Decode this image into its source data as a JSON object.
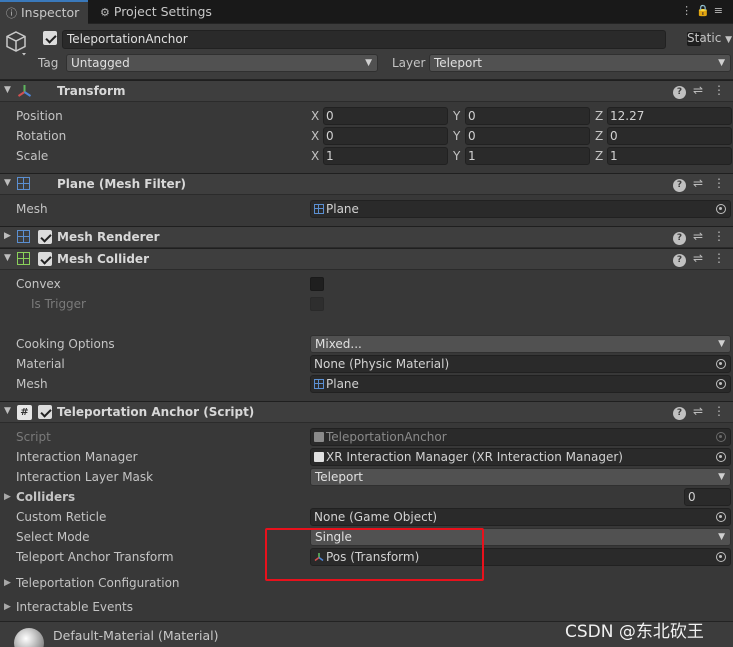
{
  "tabs": [
    {
      "label": "Inspector",
      "icon": "inspector-icon"
    },
    {
      "label": "Project Settings",
      "icon": "gear-icon"
    }
  ],
  "gameobject": {
    "name": "TeleportationAnchor",
    "static_label": "Static",
    "tag_label": "Tag",
    "tag_value": "Untagged",
    "layer_label": "Layer",
    "layer_value": "Teleport"
  },
  "transform": {
    "title": "Transform",
    "position_label": "Position",
    "rotation_label": "Rotation",
    "scale_label": "Scale",
    "axis": {
      "x": "X",
      "y": "Y",
      "z": "Z"
    },
    "position": {
      "x": "0",
      "y": "0",
      "z": "12.27"
    },
    "rotation": {
      "x": "0",
      "y": "0",
      "z": "0"
    },
    "scale": {
      "x": "1",
      "y": "1",
      "z": "1"
    }
  },
  "mesh_filter": {
    "title": "Plane (Mesh Filter)",
    "mesh_label": "Mesh",
    "mesh_value": "Plane"
  },
  "mesh_renderer": {
    "title": "Mesh Renderer"
  },
  "mesh_collider": {
    "title": "Mesh Collider",
    "convex_label": "Convex",
    "is_trigger_label": "Is Trigger",
    "cooking_label": "Cooking Options",
    "cooking_value": "Mixed...",
    "material_label": "Material",
    "material_value": "None (Physic Material)",
    "mesh_label": "Mesh",
    "mesh_value": "Plane"
  },
  "anchor": {
    "title": "Teleportation Anchor (Script)",
    "script_label": "Script",
    "script_value": "TeleportationAnchor",
    "manager_label": "Interaction Manager",
    "manager_value": "XR Interaction Manager (XR Interaction Manager)",
    "layer_mask_label": "Interaction Layer Mask",
    "layer_mask_value": "Teleport",
    "colliders_label": "Colliders",
    "colliders_count": "0",
    "reticle_label": "Custom Reticle",
    "reticle_value": "None (Game Object)",
    "select_mode_label": "Select Mode",
    "select_mode_value": "Single",
    "anchor_transform_label": "Teleport Anchor Transform",
    "anchor_transform_value": "Pos (Transform)",
    "teleport_config_label": "Teleportation Configuration",
    "events_label": "Interactable Events"
  },
  "material": {
    "title": "Default-Material (Material)"
  },
  "watermark": "CSDN @东北砍王",
  "colors": {
    "highlight": "#e8111c",
    "tab_accent": "#3a79bb"
  }
}
